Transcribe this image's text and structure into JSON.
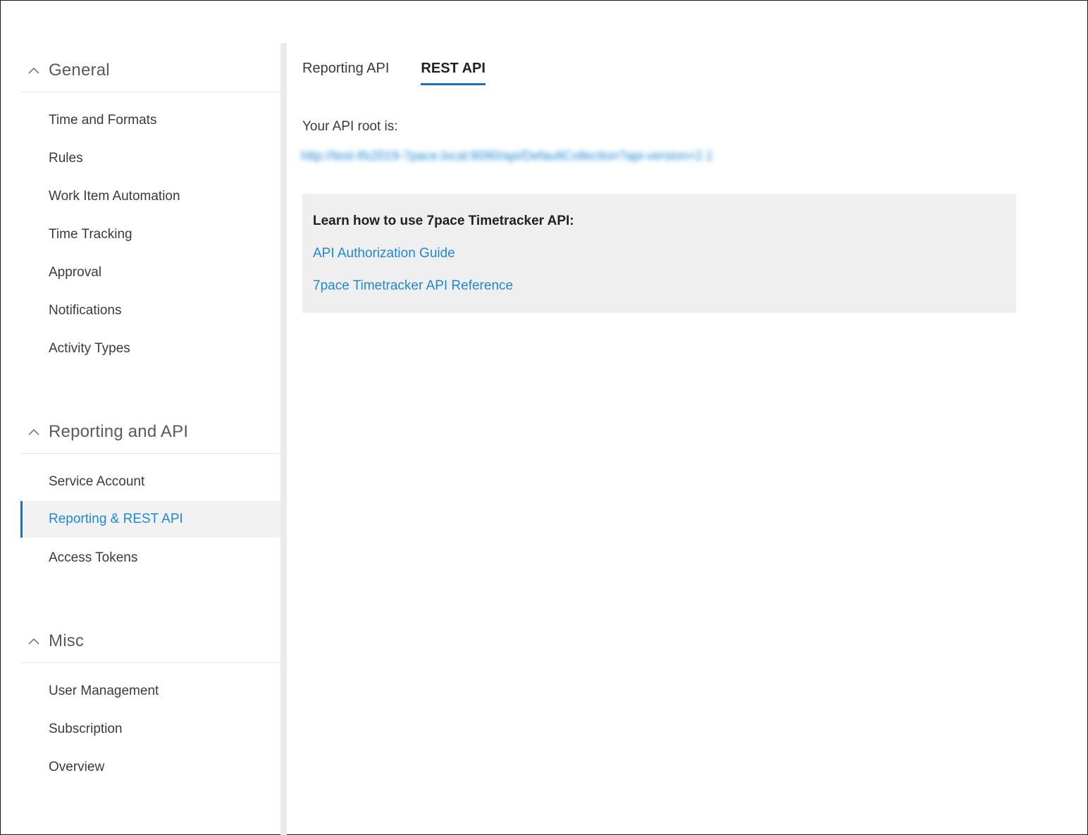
{
  "sidebar": {
    "sections": [
      {
        "title": "General",
        "items": [
          "Time and Formats",
          "Rules",
          "Work Item Automation",
          "Time Tracking",
          "Approval",
          "Notifications",
          "Activity Types"
        ]
      },
      {
        "title": "Reporting and API",
        "items": [
          "Service Account",
          "Reporting & REST API",
          "Access Tokens"
        ]
      },
      {
        "title": "Misc",
        "items": [
          "User Management",
          "Subscription",
          "Overview"
        ]
      }
    ],
    "active_item": "Reporting & REST API"
  },
  "tabs": {
    "items": [
      "Reporting API",
      "REST API"
    ],
    "active": "REST API"
  },
  "content": {
    "api_root_label": "Your API root is:",
    "api_root_url": "http://test-tfs2019-7pace.local:8090/api/DefaultCollection?api-version=2.1",
    "info_title": "Learn how to use 7pace Timetracker API:",
    "links": [
      "API Authorization Guide",
      "7pace Timetracker API Reference"
    ]
  },
  "colors": {
    "accent": "#1e6fc0",
    "link": "#1e88d4",
    "active_bg": "#f2f2f2",
    "info_bg": "#efefef"
  },
  "icons": {
    "section_toggle": "chevron-up-icon"
  }
}
